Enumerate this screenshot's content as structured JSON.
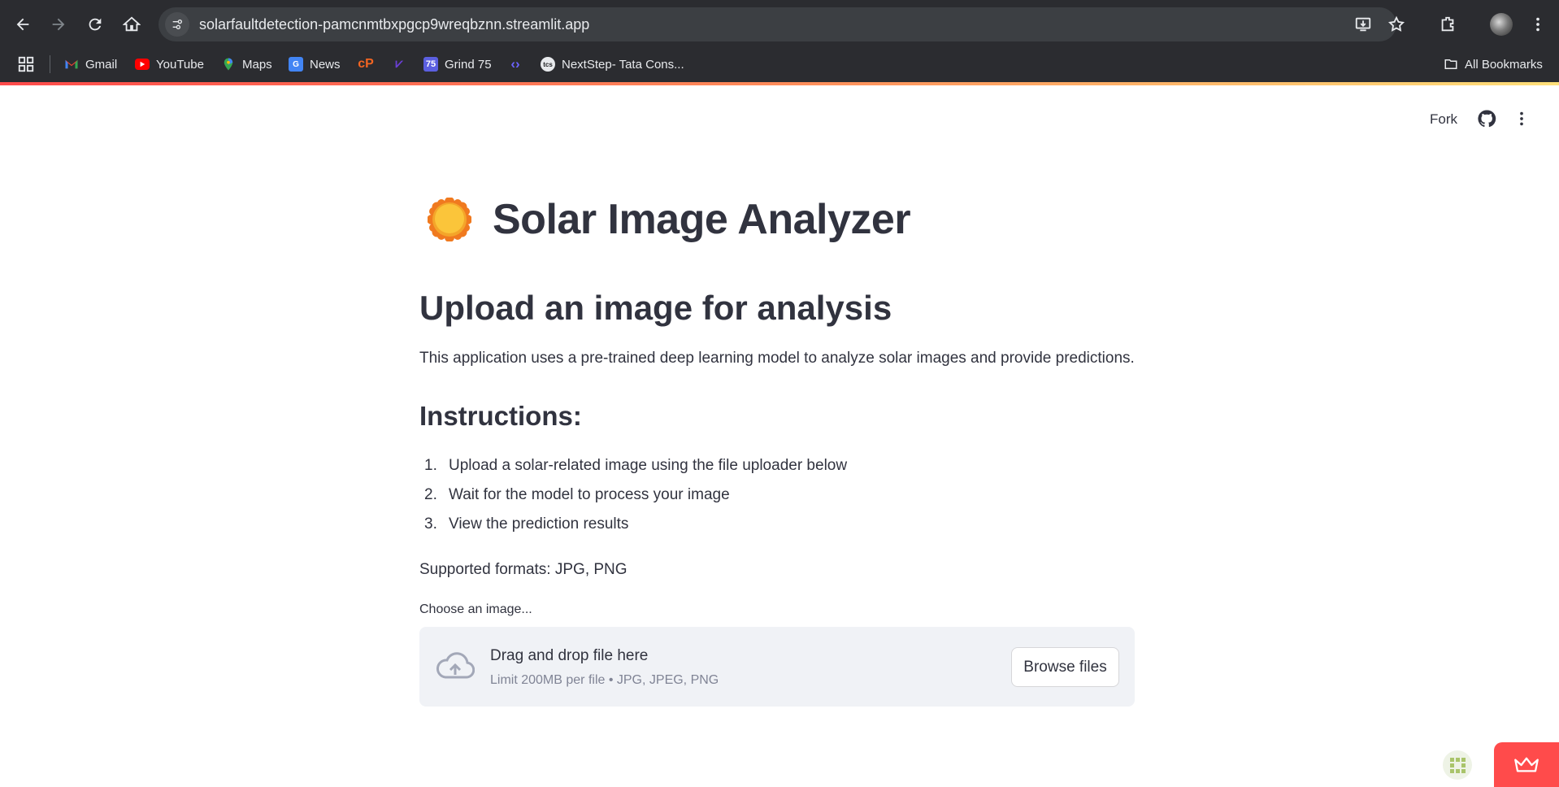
{
  "browser": {
    "url": "solarfaultdetection-pamcnmtbxpgcp9wreqbznn.streamlit.app",
    "bookmarks": [
      {
        "label": "Gmail",
        "icon": "gmail-icon"
      },
      {
        "label": "YouTube",
        "icon": "youtube-icon"
      },
      {
        "label": "Maps",
        "icon": "maps-icon"
      },
      {
        "label": "News",
        "icon": "news-icon"
      },
      {
        "label": "",
        "icon": "codeproject-icon"
      },
      {
        "label": "",
        "icon": "hackerrank-icon"
      },
      {
        "label": "Grind 75",
        "icon": "grind75-icon",
        "icon_text": "75"
      },
      {
        "label": "",
        "icon": "code-icon"
      },
      {
        "label": "NextStep- Tata Cons...",
        "icon": "tcs-icon",
        "icon_text": "tcs"
      }
    ],
    "all_bookmarks": "All Bookmarks"
  },
  "app_header": {
    "fork_label": "Fork"
  },
  "main": {
    "title": "Solar Image Analyzer",
    "subtitle": "Upload an image for analysis",
    "description": "This application uses a pre-trained deep learning model to analyze solar images and provide predictions.",
    "instructions_heading": "Instructions:",
    "instructions": [
      {
        "num": "1.",
        "text": "Upload a solar-related image using the file uploader below"
      },
      {
        "num": "2.",
        "text": "Wait for the model to process your image"
      },
      {
        "num": "3.",
        "text": "View the prediction results"
      }
    ],
    "formats": "Supported formats: JPG, PNG",
    "uploader": {
      "label": "Choose an image...",
      "drop_title": "Drag and drop file here",
      "drop_sub": "Limit 200MB per file • JPG, JPEG, PNG",
      "browse_label": "Browse files"
    }
  },
  "colors": {
    "accent": "#ff4b4b",
    "text": "#31333f",
    "dropzone_bg": "#f0f2f6"
  }
}
